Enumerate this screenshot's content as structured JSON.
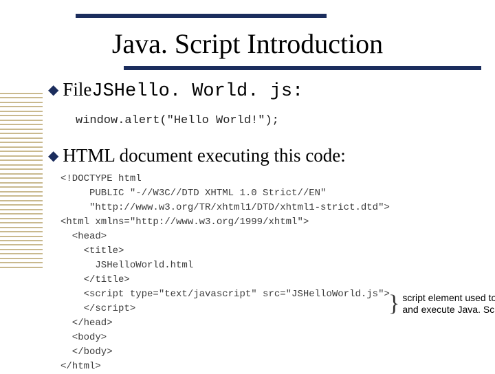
{
  "title": "Java. Script Introduction",
  "bullet1": {
    "prefix": "File ",
    "filename": "JSHello. World. js:"
  },
  "code1": "window.alert(\"Hello World!\");",
  "bullet2": "HTML document executing this code:",
  "code2": "<!DOCTYPE html\n     PUBLIC \"-//W3C//DTD XHTML 1.0 Strict//EN\"\n     \"http://www.w3.org/TR/xhtml1/DTD/xhtml1-strict.dtd\">\n<html xmlns=\"http://www.w3.org/1999/xhtml\">\n  <head>\n    <title>\n      JSHelloWorld.html\n    </title>\n    <script type=\"text/javascript\" src=\"JSHelloWorld.js\">\n    </script>\n  </head>\n  <body>\n  </body>\n</html>",
  "callout": {
    "brace": "}",
    "text": "script element used to load and execute Java. Script code"
  }
}
